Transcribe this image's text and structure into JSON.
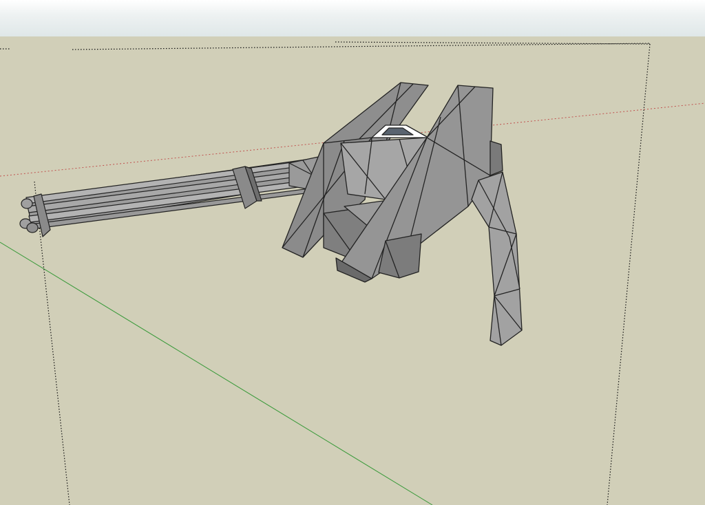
{
  "viewport": {
    "sky_color": "#e6eced",
    "ground_color": "#d1cfb8",
    "axes": {
      "red_axis_color": "#c0504d",
      "green_axis_color": "#3a9a3a",
      "dotted_guide_color": "#111111"
    },
    "model": {
      "icon": "minigun-turret-model",
      "face_colors": {
        "light": "#a9a9a9",
        "mid": "#8e8e8e",
        "dark": "#6f6f6f",
        "highlight": "#ffffff"
      }
    }
  }
}
